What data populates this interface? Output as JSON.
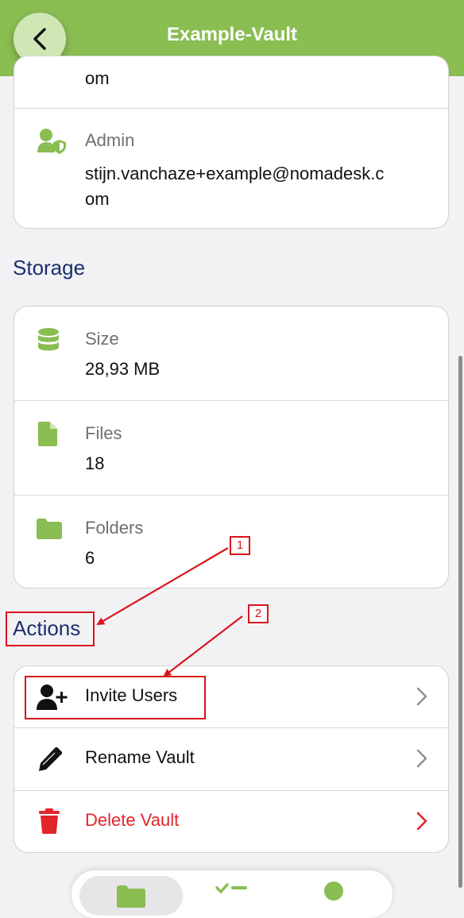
{
  "header": {
    "title": "Example-Vault",
    "back_icon": "chevron-left-icon"
  },
  "top_card": {
    "clipped_tail": "om",
    "admin": {
      "label": "Admin",
      "value_line1": "stijn.vanchaze+example@nomadesk.c",
      "value_line2": "om",
      "icon": "user-shield-icon"
    }
  },
  "storage": {
    "title": "Storage",
    "items": [
      {
        "label": "Size",
        "value": "28,93 MB",
        "icon": "database-icon"
      },
      {
        "label": "Files",
        "value": "18",
        "icon": "file-icon"
      },
      {
        "label": "Folders",
        "value": "6",
        "icon": "folder-icon"
      }
    ]
  },
  "actions": {
    "title": "Actions",
    "items": [
      {
        "label": "Invite Users",
        "icon": "user-plus-icon"
      },
      {
        "label": "Rename Vault",
        "icon": "pencil-icon"
      },
      {
        "label": "Delete Vault",
        "icon": "trash-icon"
      }
    ]
  },
  "annotations": [
    {
      "label": "1"
    },
    {
      "label": "2"
    }
  ],
  "bottom_nav": {
    "icons": [
      "folder-icon",
      "tasks-icon",
      "user-icon"
    ]
  },
  "colors": {
    "header": "#8abd52",
    "accent_green": "#8abd52",
    "section_title": "#1c2f6e",
    "delete_red": "#e3242b",
    "annotation_red": "#d9141c"
  }
}
